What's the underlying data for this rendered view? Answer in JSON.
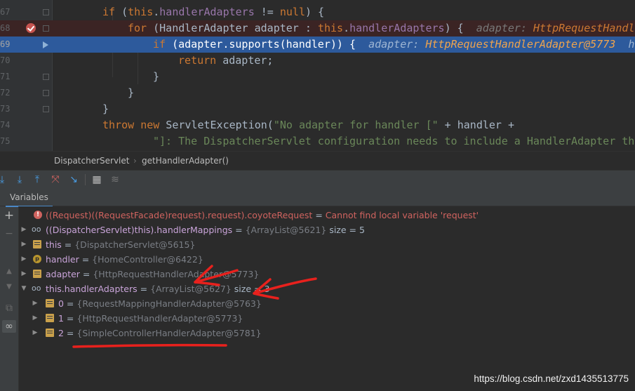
{
  "editor": {
    "lines": [
      {
        "num": "67",
        "prefix": "if (",
        "kw": "this",
        "rest": ".",
        "field": "handlerAdapters",
        "tail": " != ",
        "kw2": "null",
        "end": ") {"
      },
      {
        "num": "68",
        "kw": "for",
        "mid": " (HandlerAdapter adapter : ",
        "kw2": "this",
        "dot": ".",
        "field": "handlerAdapters",
        "end": ") {",
        "hint_name": "adapter:",
        "hint_val": "HttpRequestHandle"
      },
      {
        "num": "69",
        "kw": "if",
        "mid": " (adapter.supports(handler)) {",
        "hint_name": "adapter:",
        "hint_val": "HttpRequestHandlerAdapter@5773",
        "hint_more": "h"
      },
      {
        "num": "70",
        "kw": "return",
        "mid": " adapter;"
      },
      {
        "num": "71",
        "mid": "}"
      },
      {
        "num": "72",
        "mid": "}"
      },
      {
        "num": "73",
        "mid": "}"
      },
      {
        "num": "74",
        "kw": "throw",
        "kw2": "new",
        "mid": " ServletException(",
        "str": "\"No adapter for handler [\"",
        "end": " + handler +"
      },
      {
        "num": "75",
        "str": "\"]: The DispatcherServlet configuration needs to include a HandlerAdapter tha"
      }
    ]
  },
  "breadcrumb": {
    "items": [
      "DispatcherServlet",
      "getHandlerAdapter()"
    ],
    "separator": "›"
  },
  "toolbar": {
    "icons": [
      "step-over-icon",
      "step-into-icon",
      "step-out-icon",
      "drop-frame-icon",
      "run-to-cursor-icon",
      "evaluate-icon",
      "trace-icon"
    ]
  },
  "variables": {
    "tab_label": "Variables",
    "rows": [
      {
        "name": "((Request)((RequestFacade)request).request).coyoteRequest",
        "eq": " = ",
        "value": "Cannot find local variable 'request'",
        "type": "error"
      },
      {
        "name": "((DispatcherServlet)this).handlerMappings",
        "eq": " = ",
        "value": "{ArrayList@5621}",
        "size": "size = 5",
        "type": "watch"
      },
      {
        "name": "this",
        "eq": " = ",
        "value": "{DispatcherServlet@5615}",
        "type": "field"
      },
      {
        "name": "handler",
        "eq": " = ",
        "value": "{HomeController@6422}",
        "type": "param"
      },
      {
        "name": "adapter",
        "eq": " = ",
        "value": "{HttpRequestHandlerAdapter@5773}",
        "type": "field"
      },
      {
        "name": "this.handlerAdapters",
        "eq": " = ",
        "value": "{ArrayList@5627}",
        "size": "size = 3",
        "type": "watch"
      },
      {
        "name": "0",
        "eq": " = ",
        "value": "{RequestMappingHandlerAdapter@5763}",
        "type": "field"
      },
      {
        "name": "1",
        "eq": " = ",
        "value": "{HttpRequestHandlerAdapter@5773}",
        "type": "field"
      },
      {
        "name": "2",
        "eq": " = ",
        "value": "{SimpleControllerHandlerAdapter@5781}",
        "type": "field"
      }
    ]
  },
  "watermark": "https://blog.csdn.net/zxd1435513775",
  "colors": {
    "annotation": "#e8211d",
    "execution_line": "#2d5a9c",
    "breakpoint": "#c75450"
  }
}
